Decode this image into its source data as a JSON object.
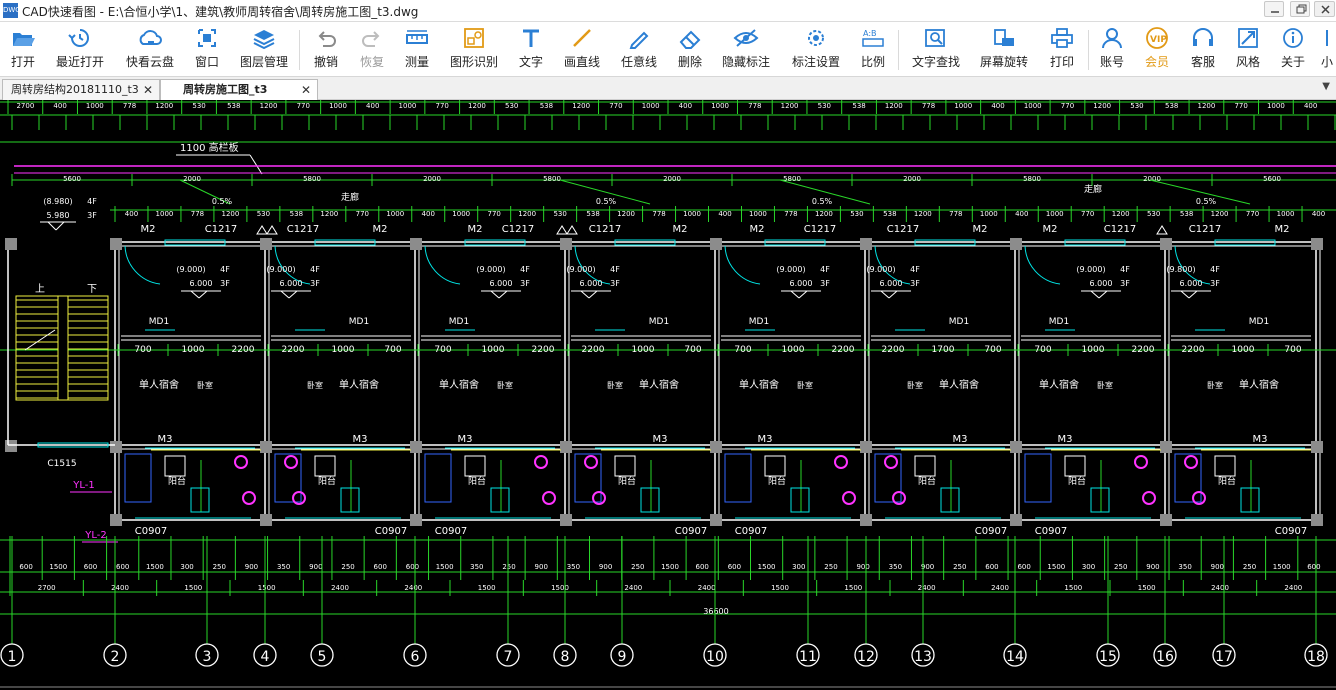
{
  "window": {
    "app_logo": "DWG",
    "title": "CAD快速看图 - E:\\合恒小学\\1、建筑\\教师周转宿舍\\周转房施工图_t3.dwg"
  },
  "toolbar": {
    "items": [
      {
        "label": "打开",
        "icon": "folder-open-icon"
      },
      {
        "label": "最近打开",
        "icon": "recent-clock-icon"
      },
      {
        "label": "快看云盘",
        "icon": "cloud-icon"
      },
      {
        "label": "窗口",
        "icon": "window-icon"
      },
      {
        "label": "图层管理",
        "icon": "layers-icon"
      },
      {
        "label": "撤销",
        "icon": "undo-icon"
      },
      {
        "label": "恢复",
        "icon": "redo-icon"
      },
      {
        "label": "测量",
        "icon": "ruler-icon"
      },
      {
        "label": "图形识别",
        "icon": "shape-recognition-icon"
      },
      {
        "label": "文字",
        "icon": "text-icon"
      },
      {
        "label": "画直线",
        "icon": "line-icon"
      },
      {
        "label": "任意线",
        "icon": "freehand-pen-icon"
      },
      {
        "label": "删除",
        "icon": "eraser-icon"
      },
      {
        "label": "隐藏标注",
        "icon": "hide-eye-icon"
      },
      {
        "label": "标注设置",
        "icon": "annotation-settings-icon"
      },
      {
        "label": "比例",
        "icon": "scale-icon"
      },
      {
        "label": "文字查找",
        "icon": "text-search-icon"
      },
      {
        "label": "屏幕旋转",
        "icon": "screen-rotate-icon"
      },
      {
        "label": "打印",
        "icon": "printer-icon"
      },
      {
        "label": "账号",
        "icon": "user-icon"
      },
      {
        "label": "会员",
        "icon": "vip-badge-icon"
      },
      {
        "label": "客服",
        "icon": "headset-icon"
      },
      {
        "label": "风格",
        "icon": "style-icon"
      },
      {
        "label": "关于",
        "icon": "info-icon"
      },
      {
        "label": "小",
        "icon": "mini-icon"
      }
    ],
    "vip_color": "#e29a16",
    "icon_color": "#2b7fd4"
  },
  "tabs": [
    {
      "label": "周转房结构20181110_t3",
      "active": false
    },
    {
      "label": "周转房施工图_t3",
      "active": true
    }
  ],
  "drawing": {
    "top_dims_row1": [
      "2700",
      "400",
      "1000",
      "778",
      "1200",
      "530",
      "538",
      "1200",
      "770",
      "1000",
      "400",
      "1000",
      "770",
      "1200",
      "530",
      "538",
      "1200",
      "770",
      "1000",
      "400",
      "1000",
      "778",
      "1200",
      "530",
      "538",
      "1200",
      "778",
      "1000",
      "400",
      "1000",
      "770",
      "1200",
      "530",
      "538",
      "1200",
      "770",
      "1000",
      "400"
    ],
    "railing_text": "1100  高栏板",
    "corridor_dims": [
      "5600",
      "2000",
      "5800",
      "2000",
      "5800",
      "2000",
      "5800",
      "2000",
      "5800",
      "2000",
      "5600"
    ],
    "slope_labels": [
      "0.5%",
      "0.5%",
      "0.5%",
      "0.5%"
    ],
    "corridor_labels": [
      "走廊",
      "走廊"
    ],
    "level_left": [
      "(8.980)",
      "4F",
      "5.980",
      "3F"
    ],
    "top_dims_row2": [
      "400",
      "1000",
      "778",
      "1200",
      "530",
      "538",
      "1200",
      "770",
      "1000",
      "400",
      "1000",
      "770",
      "1200",
      "530",
      "538",
      "1200",
      "778",
      "1000",
      "400",
      "1000",
      "778",
      "1200",
      "530",
      "538",
      "1200",
      "778",
      "1000",
      "400",
      "1000",
      "770",
      "1200",
      "530",
      "538",
      "1200",
      "770",
      "1000",
      "400"
    ],
    "door_window_top": [
      "M2",
      "C1217",
      "C1217",
      "M2",
      "M2",
      "C1217",
      "C1217",
      "M2",
      "M2",
      "C1217",
      "C1217",
      "M2",
      "M2",
      "C1217",
      "C1217",
      "M2"
    ],
    "room_levels": [
      {
        "a": "(9.000)",
        "b": "4F",
        "c": "6.000",
        "d": "3F"
      },
      {
        "a": "(9.000)",
        "b": "4F",
        "c": "6.000",
        "d": "3F"
      },
      {
        "a": "(9.000)",
        "b": "4F",
        "c": "6.000",
        "d": "3F"
      },
      {
        "a": "(9.000)",
        "b": "4F",
        "c": "6.000",
        "d": "3F"
      },
      {
        "a": "(9.000)",
        "b": "4F",
        "c": "6.000",
        "d": "3F"
      },
      {
        "a": "(9.000)",
        "b": "4F",
        "c": "6.000",
        "d": "3F"
      },
      {
        "a": "(9.000)",
        "b": "4F",
        "c": "6.000",
        "d": "3F"
      },
      {
        "a": "(9.800)",
        "b": "4F",
        "c": "6.000",
        "d": "3F"
      }
    ],
    "md1": "MD1",
    "mid_dims": [
      "700",
      "1000",
      "2200",
      "2200",
      "1000",
      "700",
      "700",
      "1000",
      "2200",
      "2200",
      "1000",
      "700",
      "700",
      "1000",
      "2200",
      "2200",
      "1700",
      "700",
      "700",
      "1000",
      "2200",
      "2200",
      "1000",
      "700"
    ],
    "dorm_label": "单人宿舍",
    "bedroom_label": "卧室",
    "m3": "M3",
    "stair_up": "上",
    "stair_down": "下",
    "c1515": "C1515",
    "yl1": "YL-1",
    "yl2": "YL-2",
    "balcony": "阳台",
    "c0907": "C0907",
    "bottom_dims_row1": [
      "600",
      "1500",
      "600",
      "600",
      "1500",
      "300",
      "250",
      "900",
      "350",
      "900",
      "250",
      "600",
      "600",
      "1500",
      "350",
      "250",
      "900",
      "350",
      "900",
      "250",
      "1500",
      "600",
      "600",
      "1500",
      "300",
      "250",
      "900",
      "350",
      "900",
      "250",
      "600",
      "600",
      "1500",
      "300",
      "250",
      "900",
      "350",
      "900",
      "250",
      "1500",
      "600"
    ],
    "bottom_dims_row2": [
      "2700",
      "2400",
      "1500",
      "1500",
      "2400",
      "2400",
      "1500",
      "1500",
      "2400",
      "2400",
      "1500",
      "1500",
      "2400",
      "2400",
      "1500",
      "1500",
      "2400",
      "2400"
    ],
    "total_dim": "36600",
    "axis_labels": [
      "1",
      "2",
      "3",
      "4",
      "5",
      "6",
      "7",
      "8",
      "9",
      "10",
      "11",
      "12",
      "13",
      "14",
      "15",
      "16",
      "17",
      "18"
    ]
  }
}
